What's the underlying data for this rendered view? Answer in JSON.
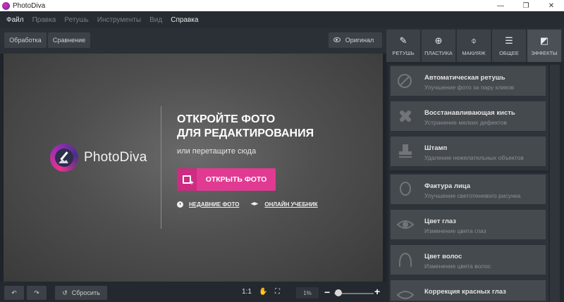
{
  "window": {
    "title": "PhotoDiva",
    "controls": [
      "—",
      "❐",
      "✕"
    ]
  },
  "menu": [
    "Файл",
    "Правка",
    "Ретушь",
    "Инструменты",
    "Вид",
    "Справка"
  ],
  "topbar": {
    "process": "Обработка",
    "compare": "Сравнение",
    "original": "Оригинал"
  },
  "canvas": {
    "logo_text_a": "Photo",
    "logo_text_b": "Diva",
    "title_line1": "ОТКРОЙТЕ ФОТО",
    "title_line2": "ДЛЯ РЕДАКТИРОВАНИЯ",
    "subtitle": "или перетащите сюда",
    "open_button": "ОТКРЫТЬ ФОТО",
    "recent": "НЕДАВНИЕ ФОТО",
    "tutorial": "ОНЛАЙН УЧЕБНИК"
  },
  "bottombar": {
    "reset": "Сбросить",
    "ratio": "1:1",
    "zoom": "1%",
    "zoom_level": 0.05
  },
  "tabs": [
    {
      "label": "РЕТУШЬ",
      "icon": "retouch-icon"
    },
    {
      "label": "ПЛАСТИКА",
      "icon": "plastic-icon"
    },
    {
      "label": "МАКИЯЖ",
      "icon": "makeup-icon"
    },
    {
      "label": "ОБЩЕЕ",
      "icon": "sliders-icon"
    },
    {
      "label": "ЭФФЕКТЫ",
      "icon": "effects-icon"
    }
  ],
  "tools": [
    {
      "title": "Автоматическая ретушь",
      "desc": "Улучшение фото за пару кликов"
    },
    {
      "title": "Восстанавливающая кисть",
      "desc": "Устранение мелких дефектов"
    },
    {
      "title": "Штамп",
      "desc": "Удаление нежелательных объектов"
    },
    {
      "title": "Фактура лица",
      "desc": "Улучшение светотеневого рисунка"
    },
    {
      "title": "Цвет глаз",
      "desc": "Изменение цвета глаз"
    },
    {
      "title": "Цвет волос",
      "desc": "Изменение цвета волос"
    },
    {
      "title": "Коррекция красных глаз",
      "desc": ""
    }
  ],
  "colors": {
    "accent": "#e13a92",
    "panel": "#2a3035",
    "canvas": "#555555"
  }
}
